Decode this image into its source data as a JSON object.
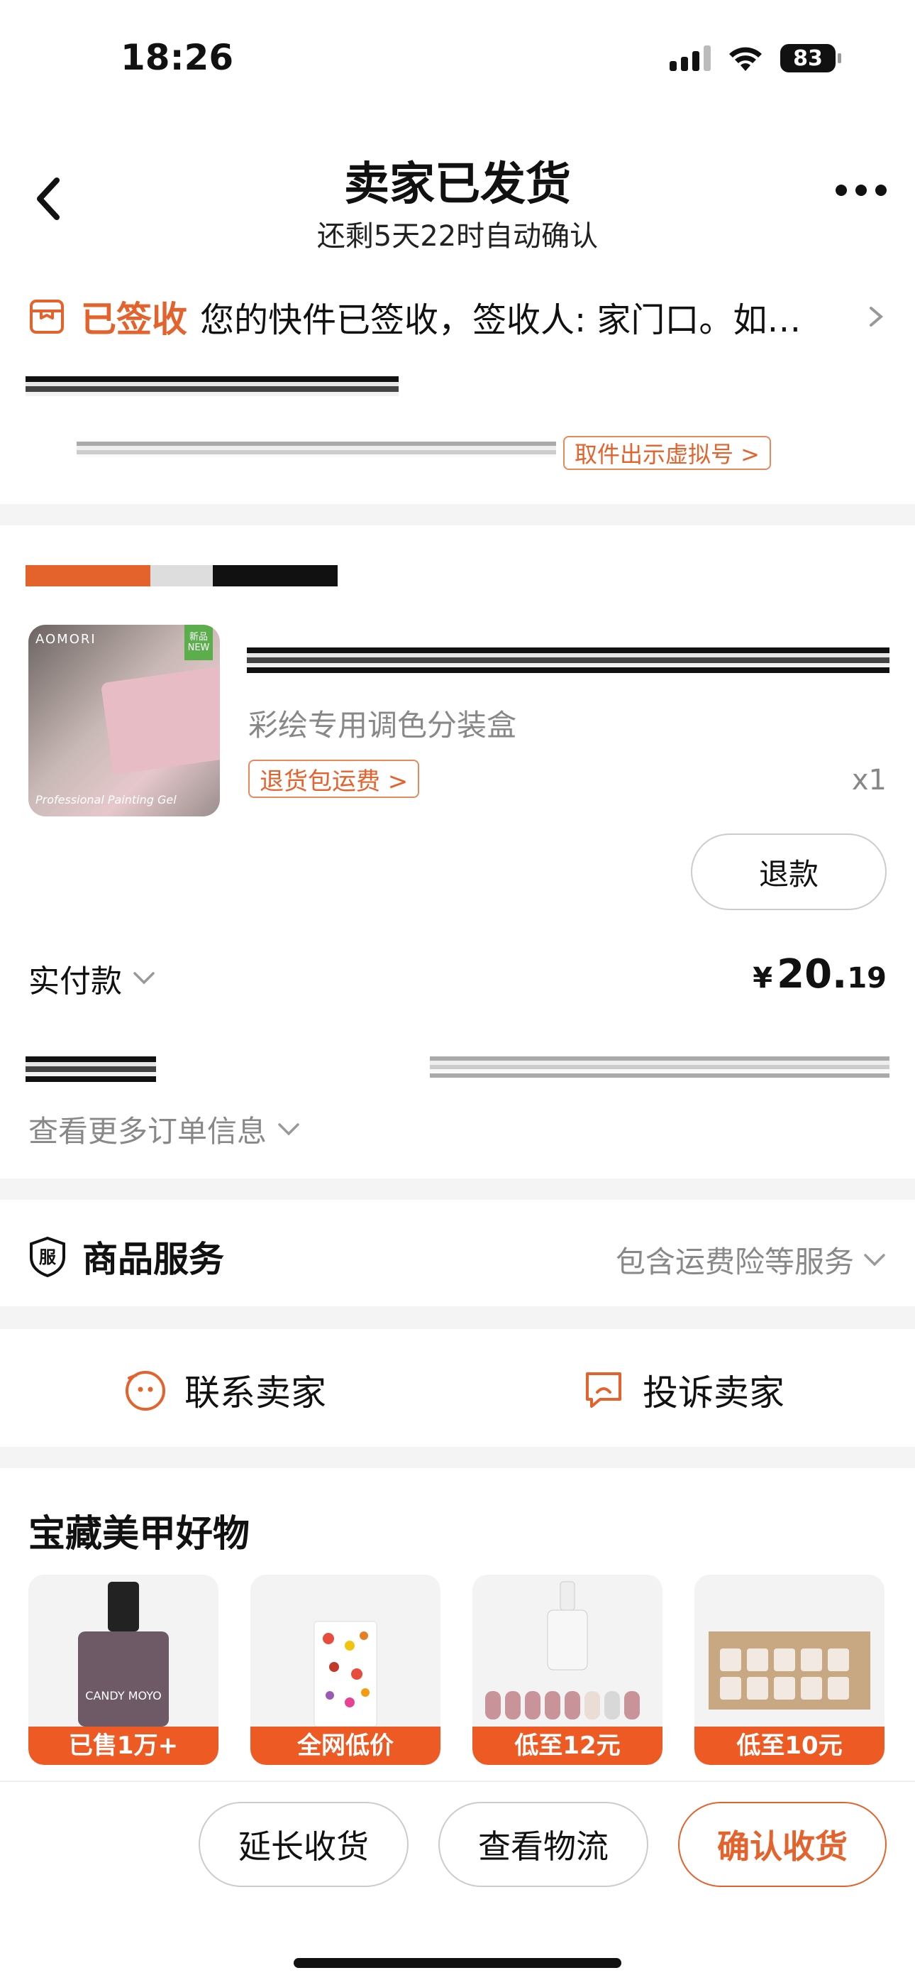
{
  "status": {
    "time": "18:26",
    "battery": "83"
  },
  "header": {
    "title": "卖家已发货",
    "subtitle": "还剩5天22时自动确认"
  },
  "logistics": {
    "status_tag": "已签收",
    "message": "您的快件已签收，签收人: 家门口。如…",
    "virtual_number_button": "取件出示虚拟号 >"
  },
  "order": {
    "product_spec": "彩绘专用调色分装盒",
    "return_shipping_button": "退货包运费 >",
    "quantity": "x1",
    "refund_button": "退款",
    "paid_label": "实付款",
    "paid_currency": "¥",
    "paid_integer": "20.",
    "paid_decimal": "19",
    "more_info": "查看更多订单信息",
    "image": {
      "brand": "AOMORI",
      "new_tag": "新品 NEW",
      "caption": "Professional Painting Gel"
    }
  },
  "service": {
    "icon_char": "服",
    "title": "商品服务",
    "description": "包含运费险等服务"
  },
  "contact": {
    "contact_seller": "联系卖家",
    "complain_seller": "投诉卖家"
  },
  "recommend": {
    "title": "宝藏美甲好物",
    "items": [
      {
        "tag": "已售1万+",
        "label": "CANDY MOYO"
      },
      {
        "tag": "全网低价"
      },
      {
        "tag": "低至12元"
      },
      {
        "tag": "低至10元"
      }
    ]
  },
  "actions": {
    "extend": "延长收货",
    "logistics": "查看物流",
    "confirm": "确认收货"
  },
  "colors": {
    "accent": "#e4622c",
    "promo": "#ee5a24"
  }
}
